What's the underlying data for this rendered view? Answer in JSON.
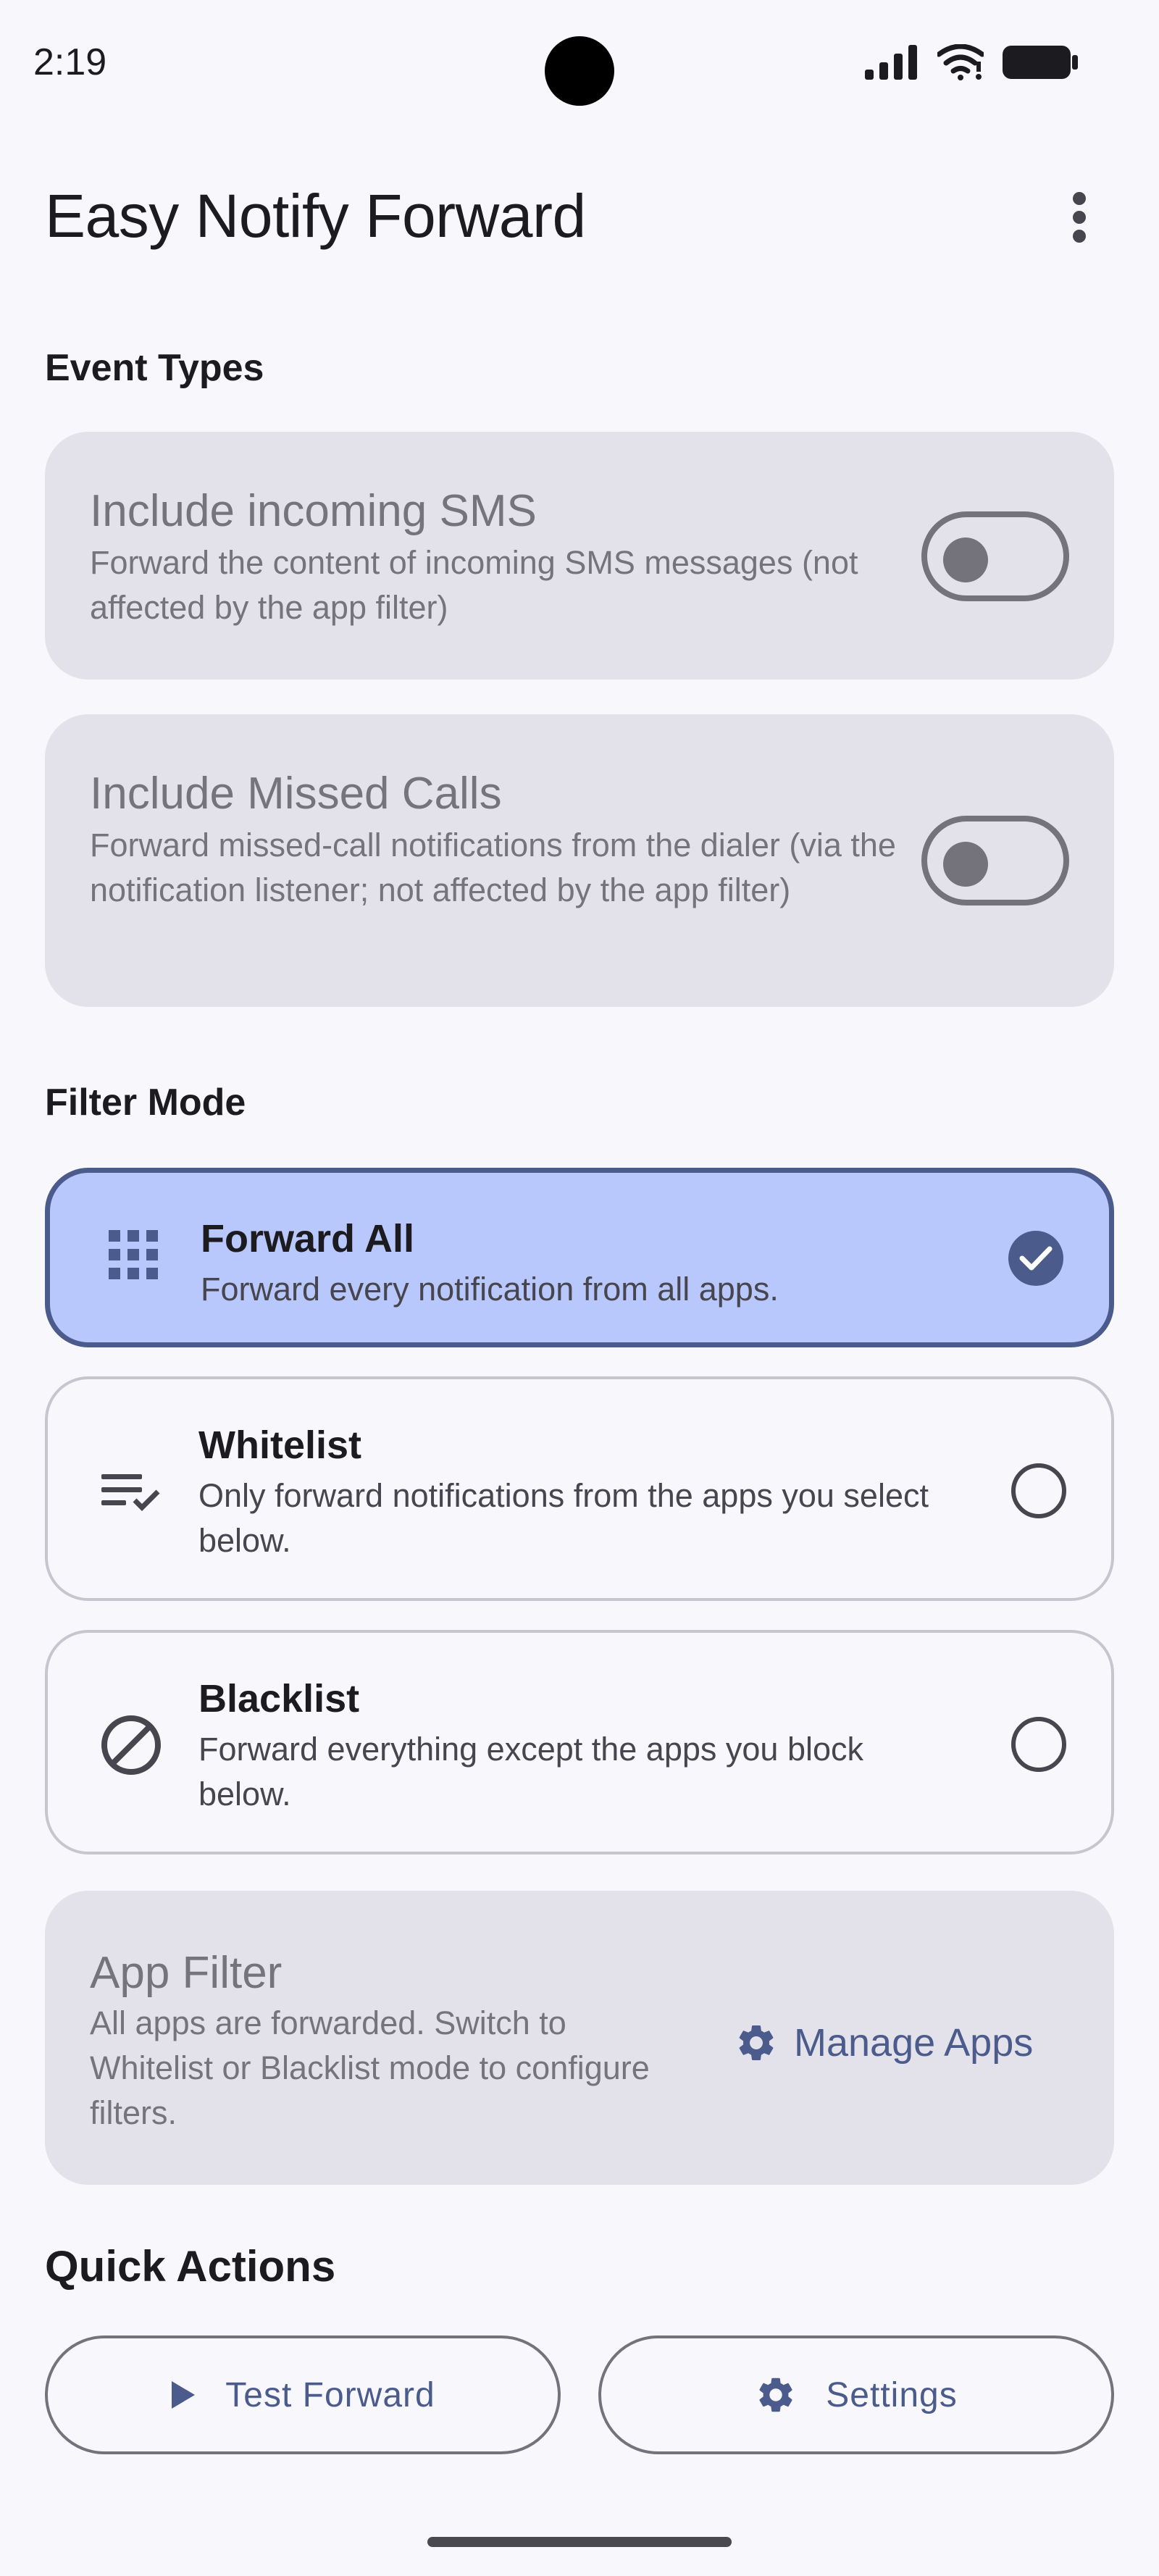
{
  "status_bar": {
    "time": "2:19",
    "icons": [
      "signal-icon",
      "wifi-icon",
      "battery-icon"
    ]
  },
  "app_bar": {
    "title": "Easy Notify Forward",
    "overflow_icon": "more-vert-icon"
  },
  "event_types": {
    "section_title": "Event Types",
    "items": [
      {
        "title": "Include incoming SMS",
        "desc": "Forward the content of incoming SMS messages (not affected by the app filter)",
        "enabled": false
      },
      {
        "title": "Include Missed Calls",
        "desc": "Forward missed-call notifications from the dialer (via the notification listener; not affected by the app filter)",
        "enabled": false
      }
    ]
  },
  "filter_mode": {
    "section_title": "Filter Mode",
    "selected": "Forward All",
    "options": [
      {
        "title": "Forward All",
        "desc": "Forward every notification from all apps.",
        "icon": "apps-grid-icon",
        "selected": true
      },
      {
        "title": "Whitelist",
        "desc": "Only forward notifications from the apps you select below.",
        "icon": "playlist-check-icon",
        "selected": false
      },
      {
        "title": "Blacklist",
        "desc": "Forward everything except the apps you block below.",
        "icon": "block-icon",
        "selected": false
      }
    ]
  },
  "app_filter": {
    "title": "App Filter",
    "desc": "All apps are forwarded. Switch to Whitelist or Blacklist mode to configure filters.",
    "manage_label": "Manage Apps",
    "manage_icon": "gear-icon"
  },
  "quick_actions": {
    "section_title": "Quick Actions",
    "test_label": "Test Forward",
    "test_icon": "play-icon",
    "settings_label": "Settings",
    "settings_icon": "gear-icon"
  },
  "colors": {
    "background": "#F8F7FC",
    "accent": "#4A5B8C",
    "selected_card": "#B9C8FC",
    "disabled_card": "#E3E2EB",
    "muted_text": "#75747C"
  }
}
